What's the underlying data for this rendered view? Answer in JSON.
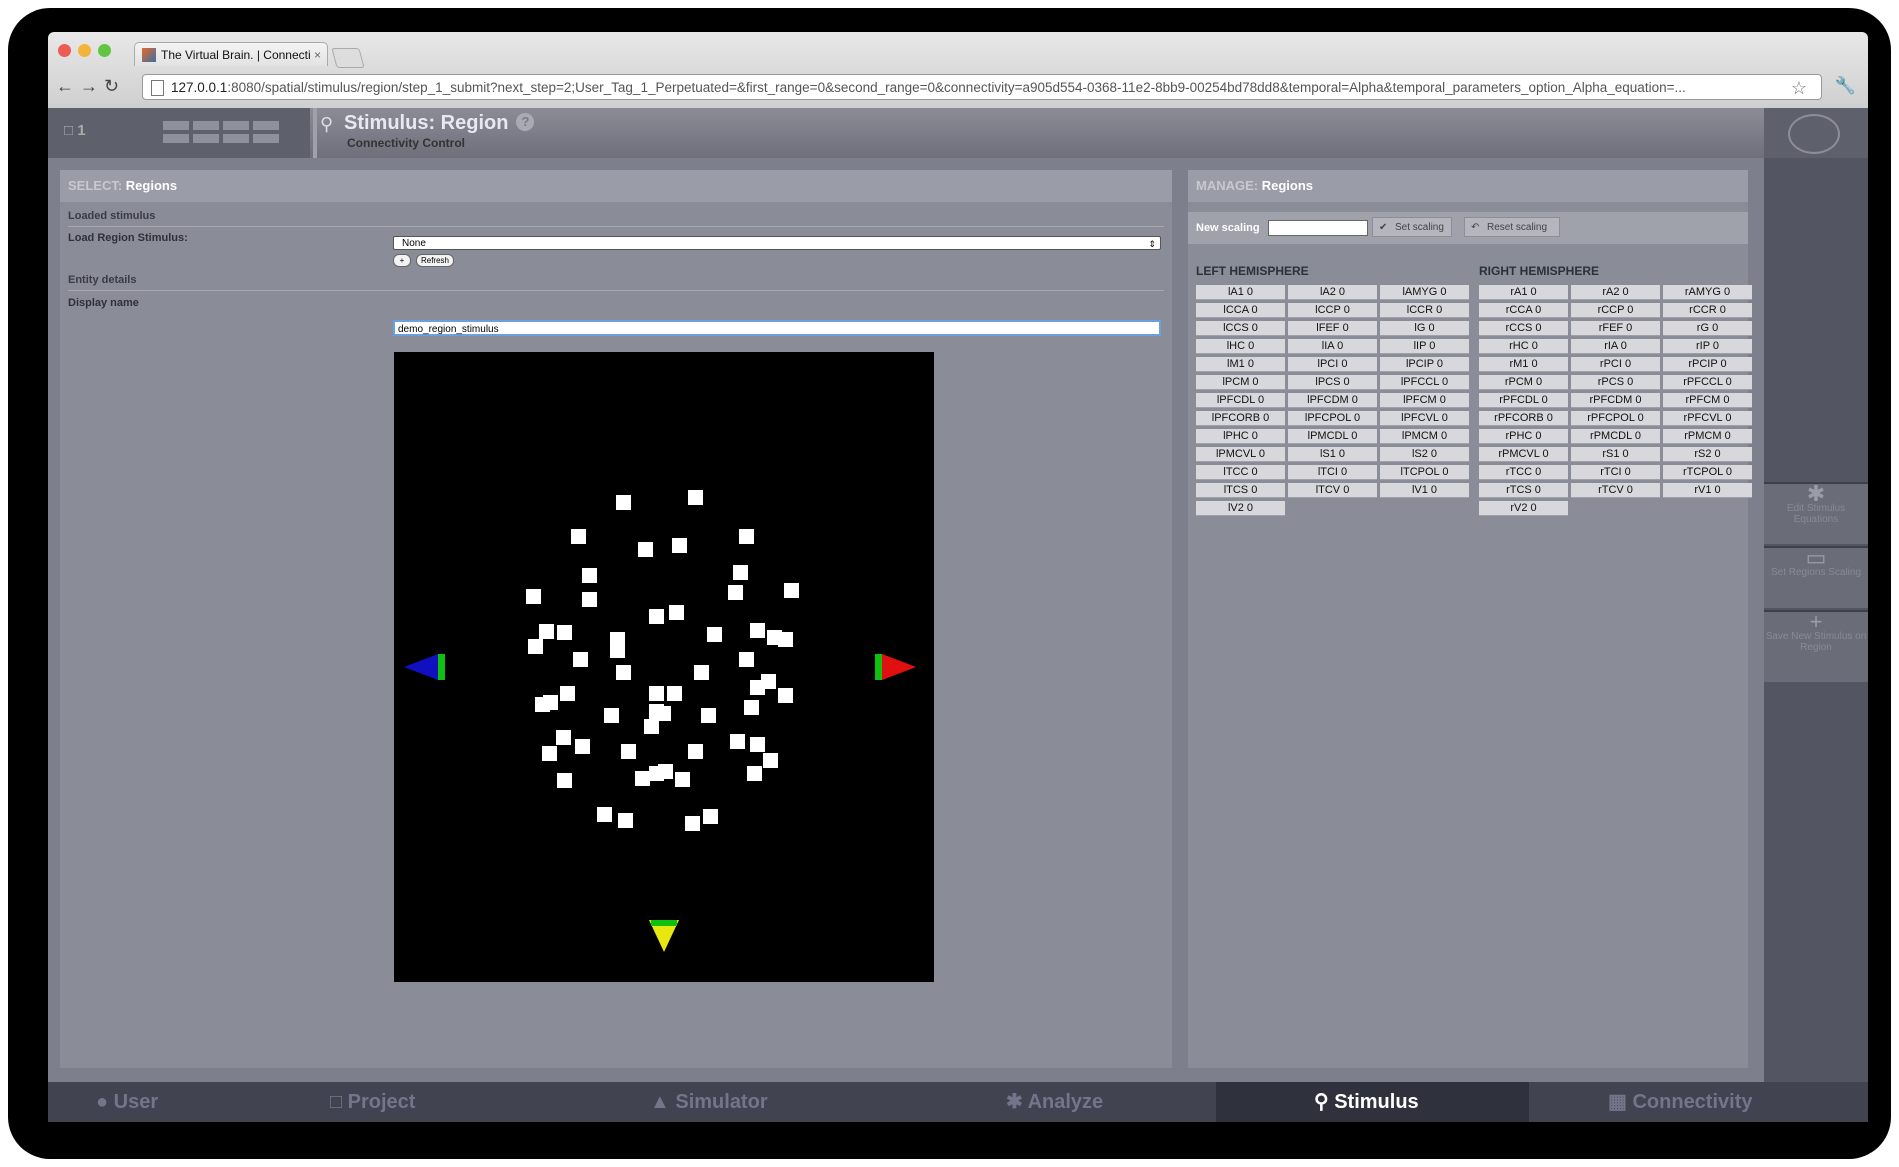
{
  "browser": {
    "tab_title": "The Virtual Brain. | Connecti",
    "tab_close": "×",
    "url_host": "127.0.0.1",
    "url_rest": ":8080/spatial/stimulus/region/step_1_submit?next_step=2;User_Tag_1_Perpetuated=&first_range=0&second_range=0&connectivity=a905d554-0368-11e2-8bb9-00254bd78dd8&temporal=Alpha&temporal_parameters_option_Alpha_equation=..."
  },
  "header": {
    "project_number": "1",
    "title": "Stimulus: Region",
    "help": "?",
    "subtitle": "Connectivity Control"
  },
  "select_panel": {
    "heading_prefix": "SELECT:",
    "heading": "Regions",
    "section_loaded": "Loaded stimulus",
    "load_label": "Load Region Stimulus:",
    "load_value": "None",
    "add_button": "+",
    "refresh_button": "Refresh",
    "section_entity": "Entity details",
    "display_name_label": "Display name",
    "display_name_value": "demo_region_stimulus"
  },
  "manage_panel": {
    "heading_prefix": "MANAGE:",
    "heading": "Regions",
    "new_scaling_label": "New scaling",
    "set_scaling": "Set scaling",
    "reset_scaling": "Reset scaling",
    "left_title": "LEFT HEMISPHERE",
    "right_title": "RIGHT HEMISPHERE",
    "left_regions": [
      "lA1 0",
      "lA2 0",
      "lAMYG 0",
      "lCCA 0",
      "lCCP 0",
      "lCCR 0",
      "lCCS 0",
      "lFEF 0",
      "lG 0",
      "lHC 0",
      "lIA 0",
      "lIP 0",
      "lM1 0",
      "lPCI 0",
      "lPCIP 0",
      "lPCM 0",
      "lPCS 0",
      "lPFCCL 0",
      "lPFCDL 0",
      "lPFCDM 0",
      "lPFCM 0",
      "lPFCORB 0",
      "lPFCPOL 0",
      "lPFCVL 0",
      "lPHC 0",
      "lPMCDL 0",
      "lPMCM 0",
      "lPMCVL 0",
      "lS1 0",
      "lS2 0",
      "lTCC 0",
      "lTCI 0",
      "lTCPOL 0",
      "lTCS 0",
      "lTCV 0",
      "lV1 0",
      "lV2 0"
    ],
    "right_regions": [
      "rA1 0",
      "rA2 0",
      "rAMYG 0",
      "rCCA 0",
      "rCCP 0",
      "rCCR 0",
      "rCCS 0",
      "rFEF 0",
      "rG 0",
      "rHC 0",
      "rIA 0",
      "rIP 0",
      "rM1 0",
      "rPCI 0",
      "rPCIP 0",
      "rPCM 0",
      "rPCS 0",
      "rPFCCL 0",
      "rPFCDL 0",
      "rPFCDM 0",
      "rPFCM 0",
      "rPFCORB 0",
      "rPFCPOL 0",
      "rPFCVL 0",
      "rPHC 0",
      "rPMCDL 0",
      "rPMCM 0",
      "rPMCVL 0",
      "rS1 0",
      "rS2 0",
      "rTCC 0",
      "rTCI 0",
      "rTCPOL 0",
      "rTCS 0",
      "rTCV 0",
      "rV1 0",
      "rV2 0"
    ]
  },
  "side_actions": {
    "edit_equations": "Edit Stimulus Equations",
    "set_scaling": "Set Regions Scaling",
    "save_new": "Save New Stimulus on Region"
  },
  "footer": {
    "user": "User",
    "project": "Project",
    "simulator": "Simulator",
    "analyze": "Analyze",
    "stimulus": "Stimulus",
    "connectivity": "Connectivity"
  },
  "colors": {
    "axis_left": "#1010c0",
    "axis_right": "#e01010",
    "axis_bottom": "#e8e810",
    "axis_green": "#10c010"
  }
}
